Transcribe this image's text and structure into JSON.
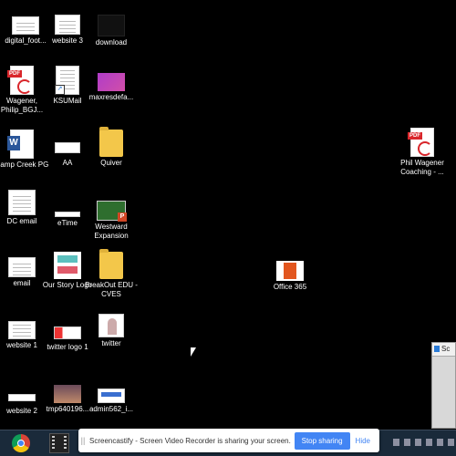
{
  "desktop": {
    "icons": [
      {
        "label": "digital_foot...",
        "kind": "doc"
      },
      {
        "label": "website 3",
        "kind": "doc"
      },
      {
        "label": "download",
        "kind": "dark"
      },
      {
        "label": "Wagener, Philip_BGJ...",
        "kind": "pdf"
      },
      {
        "label": "KSUMail",
        "kind": "shortcut-doc"
      },
      {
        "label": "maxresdefa...",
        "kind": "image-purple"
      },
      {
        "label": "Camp Creek PG",
        "kind": "word"
      },
      {
        "label": "AA",
        "kind": "doc-small"
      },
      {
        "label": "Quiver",
        "kind": "folder"
      },
      {
        "label": "DC email",
        "kind": "doc"
      },
      {
        "label": "eTime",
        "kind": "doc-small"
      },
      {
        "label": "Westward Expansion",
        "kind": "ppt"
      },
      {
        "label": "email",
        "kind": "doc"
      },
      {
        "label": "Our Story Logo",
        "kind": "image-teal"
      },
      {
        "label": "BreakOut EDU - CVES",
        "kind": "folder"
      },
      {
        "label": "website 1",
        "kind": "doc"
      },
      {
        "label": "twitter logo 1",
        "kind": "image-banner"
      },
      {
        "label": "twitter",
        "kind": "image-person"
      },
      {
        "label": "website 2",
        "kind": "doc-small"
      },
      {
        "label": "tmp640196...",
        "kind": "image-photo"
      },
      {
        "label": "admin562_i...",
        "kind": "image-blue"
      },
      {
        "label": "Office 365",
        "kind": "office"
      },
      {
        "label": "Phil Wagener Coaching - ...",
        "kind": "pdf"
      }
    ]
  },
  "share_bar": {
    "grip": "||",
    "message": "Screencastify - Screen Video Recorder is sharing your screen.",
    "stop_label": "Stop sharing",
    "hide_label": "Hide"
  },
  "side_window": {
    "title": "Sc"
  },
  "colors": {
    "desktop": "#000000",
    "taskbar": "#1a2a3a",
    "accent": "#4285f4"
  }
}
